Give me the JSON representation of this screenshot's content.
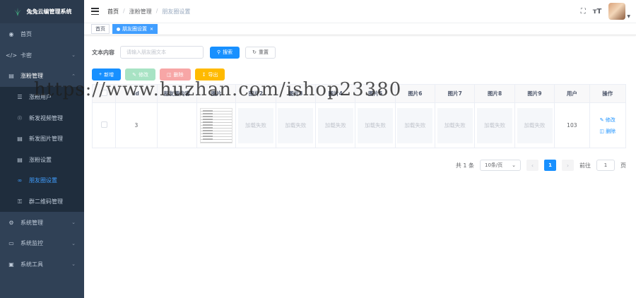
{
  "app": {
    "title": "兔兔云编管理系统"
  },
  "sidebar": {
    "items": [
      {
        "label": "首页",
        "icon": "dashboard-icon"
      },
      {
        "label": "卡密",
        "icon": "code-icon"
      },
      {
        "label": "涨粉管理",
        "icon": "document-icon"
      }
    ],
    "submenu": [
      {
        "label": "涨粉用户",
        "icon": "user-list-icon"
      },
      {
        "label": "新发视频管理",
        "icon": "eye-icon"
      },
      {
        "label": "新发图片管理",
        "icon": "document-icon"
      },
      {
        "label": "涨粉设置",
        "icon": "document-icon"
      },
      {
        "label": "朋友圈设置",
        "icon": "link-icon"
      },
      {
        "label": "群二维码管理",
        "icon": "key-icon"
      }
    ],
    "bottom": [
      {
        "label": "系统管理",
        "icon": "gear-icon"
      },
      {
        "label": "系统监控",
        "icon": "monitor-icon"
      },
      {
        "label": "系统工具",
        "icon": "toolbox-icon"
      }
    ]
  },
  "breadcrumb": [
    "首页",
    "涨粉管理",
    "朋友圈设置"
  ],
  "tags": {
    "home": "首页",
    "current": "朋友圈设置"
  },
  "search": {
    "label": "文本内容",
    "placeholder": "请输入朋友圈文本",
    "search_btn": "搜索",
    "reset_btn": "重置"
  },
  "toolbar": {
    "add": "新增",
    "edit": "修改",
    "delete": "删除",
    "export": "导出"
  },
  "table": {
    "headers": [
      "",
      "id",
      "朋友圈内容",
      "图片",
      "图片2",
      "图片3",
      "图片4",
      "图片5",
      "图片6",
      "图片7",
      "图片8",
      "图片9",
      "用户",
      "操作"
    ],
    "rows": [
      {
        "id": "3",
        "content": "",
        "img_fail": "加载失败",
        "user": "103",
        "edit": "修改",
        "delete": "删除"
      }
    ]
  },
  "pagination": {
    "total": "共 1 条",
    "page_size": "10条/页",
    "current": "1",
    "goto_prefix": "前往",
    "goto_value": "1",
    "goto_suffix": "页"
  },
  "watermark": "https://www.huzhan.com/ishop23380",
  "colors": {
    "sidebar_bg": "#304156",
    "primary": "#1890ff",
    "active_menu": "#409eff"
  }
}
